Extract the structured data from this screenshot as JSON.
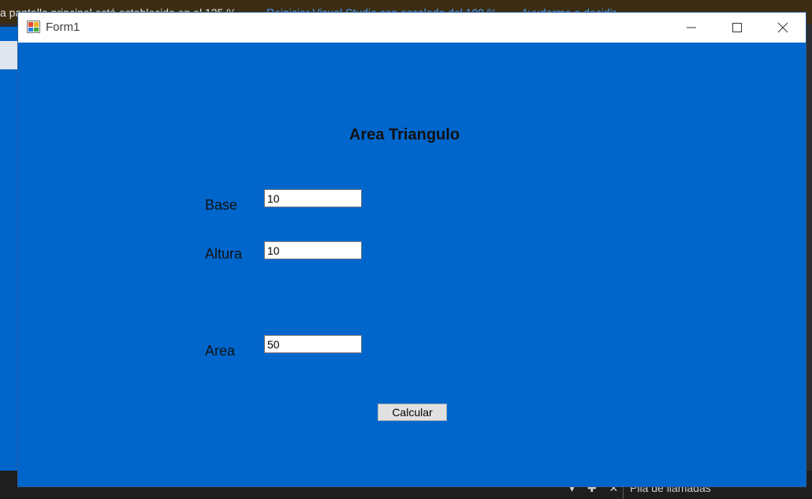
{
  "vs": {
    "infobar_message": "a pantalla principal está establecido en el 125 %.",
    "infobar_link_restart": "Reiniciar Visual Studio con escalado del 100 %",
    "infobar_link_help": "Ayudarme a decidir",
    "bottom_panel_title": "Pila de llamadas",
    "bottom_tools": "▾ ✚ ✕"
  },
  "window": {
    "title": "Form1"
  },
  "form": {
    "heading": "Area Triangulo",
    "base_label": "Base",
    "base_value": "10",
    "altura_label": "Altura",
    "altura_value": "10",
    "area_label": "Area",
    "area_value": "50",
    "calc_button": "Calcular"
  },
  "colors": {
    "form_background": "#0066cc",
    "infobar_background": "#3b2c12",
    "link": "#4aa3ff"
  }
}
